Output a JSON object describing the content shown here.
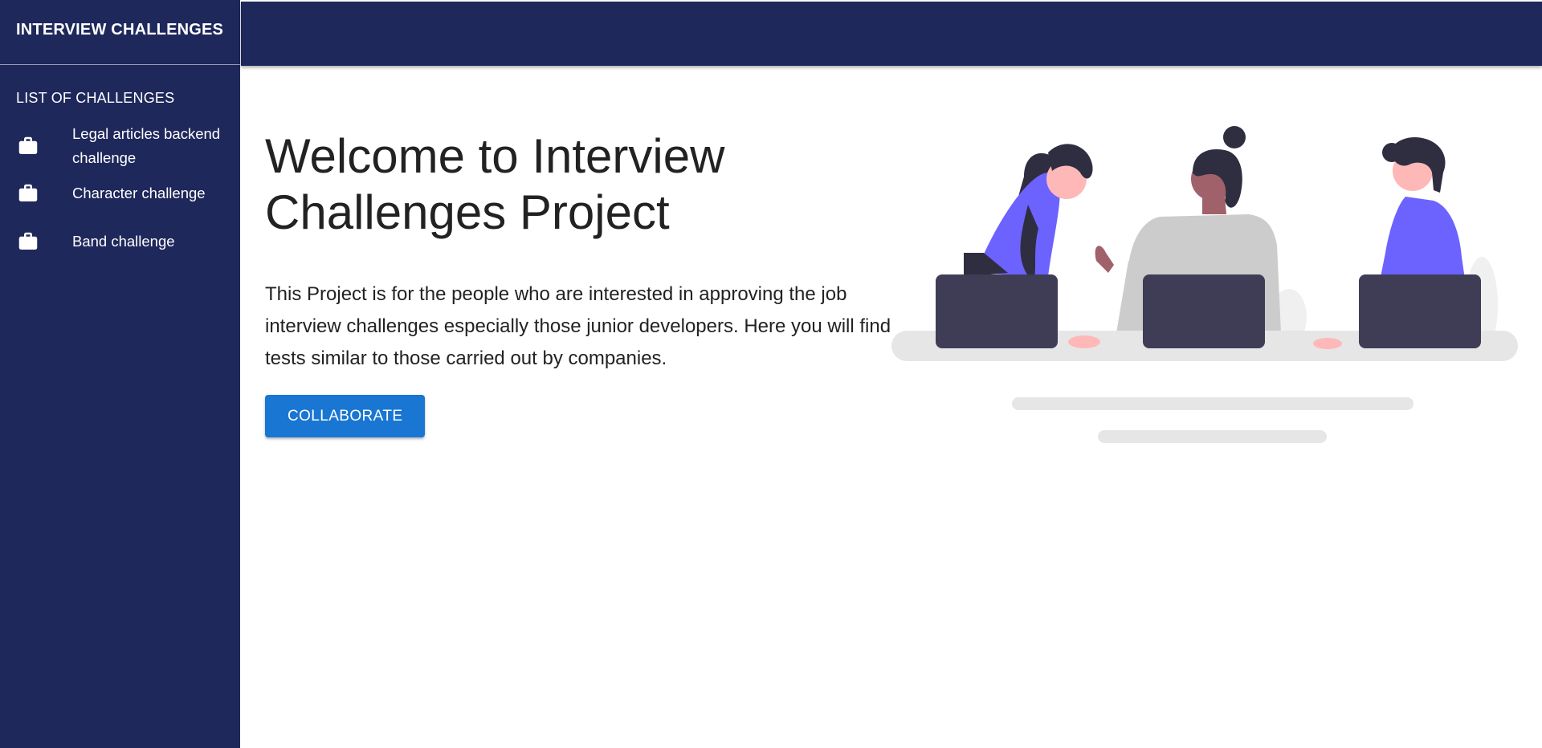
{
  "sidebar": {
    "app_title": "INTERVIEW CHALLENGES",
    "section_title": "LIST OF CHALLENGES",
    "items": [
      {
        "label": "Legal articles backend challenge",
        "icon": "briefcase-icon"
      },
      {
        "label": "Character challenge",
        "icon": "briefcase-icon"
      },
      {
        "label": "Band challenge",
        "icon": "briefcase-icon"
      }
    ]
  },
  "main": {
    "headline": "Welcome to Interview Challenges Project",
    "description": "This Project is for the people who are interested in approving the job interview challenges especially those junior developers. Here you will find tests similar to those carried out by companies.",
    "cta_label": "COLLABORATE"
  },
  "colors": {
    "sidebar_bg": "#1f285b",
    "topbar_bg": "#1f285b",
    "button_bg": "#1976d2",
    "illustration_accent": "#6c63ff",
    "laptop": "#3f3d56"
  }
}
